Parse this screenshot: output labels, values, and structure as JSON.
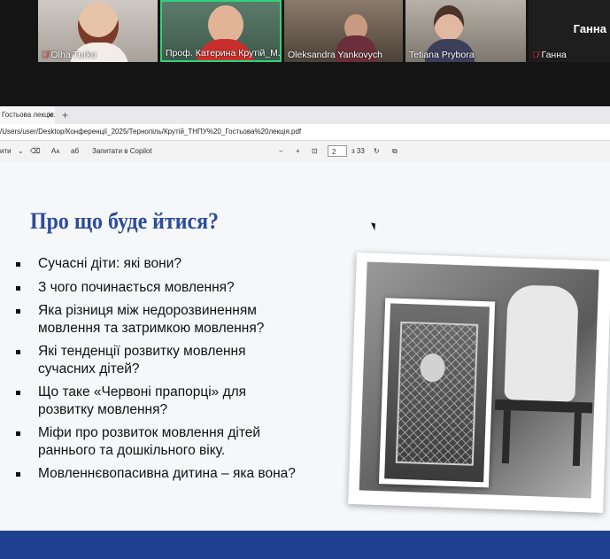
{
  "participants": [
    {
      "name": "Olha Turko",
      "muted": true
    },
    {
      "name": "Проф. Катерина Крутій_М...",
      "muted": false,
      "active_speaker": true
    },
    {
      "name": "Oleksandra Yankovych",
      "muted": false
    },
    {
      "name": "Tetiana Prybora",
      "muted": false
    },
    {
      "name": "Ганна",
      "muted": true,
      "big_name": "Ганна"
    }
  ],
  "mic_icon": "mic-muted-icon",
  "browser": {
    "tab_title": "Гостьова лекція.pd",
    "tab_close": "✕",
    "new_tab": "+",
    "url": "/Users/user/Desktop/Конференції_2025/Тернопіль/Крутій_ТНПУ%20_Гостьова%20лекція.pdf"
  },
  "pdf_toolbar": {
    "left_item": "ити",
    "ask_copilot": "Запитати в Copilot",
    "zoom_out": "−",
    "zoom_in": "+",
    "page_current": "2",
    "page_total": "з 33",
    "read_aloud": "Aᴀ",
    "text_label": "аб"
  },
  "slide": {
    "title": "Про що буде йтися?",
    "bullets": [
      "Сучасні діти: які вони?",
      "З чого починається мовлення?",
      "Яка різниця між недорозвиненням мовлення та затримкою мовлення?",
      "Які тенденції розвитку мовлення сучасних дітей?",
      "Що таке «Червоні прапорці» для розвитку мовлення?",
      "Міфи про розвиток мовлення дітей раннього та дошкільного віку.",
      "Мовленнєвопасивна дитина – яка вона?"
    ],
    "accent_color": "#2c4c9a",
    "footer_color": "#1f3f8f"
  }
}
